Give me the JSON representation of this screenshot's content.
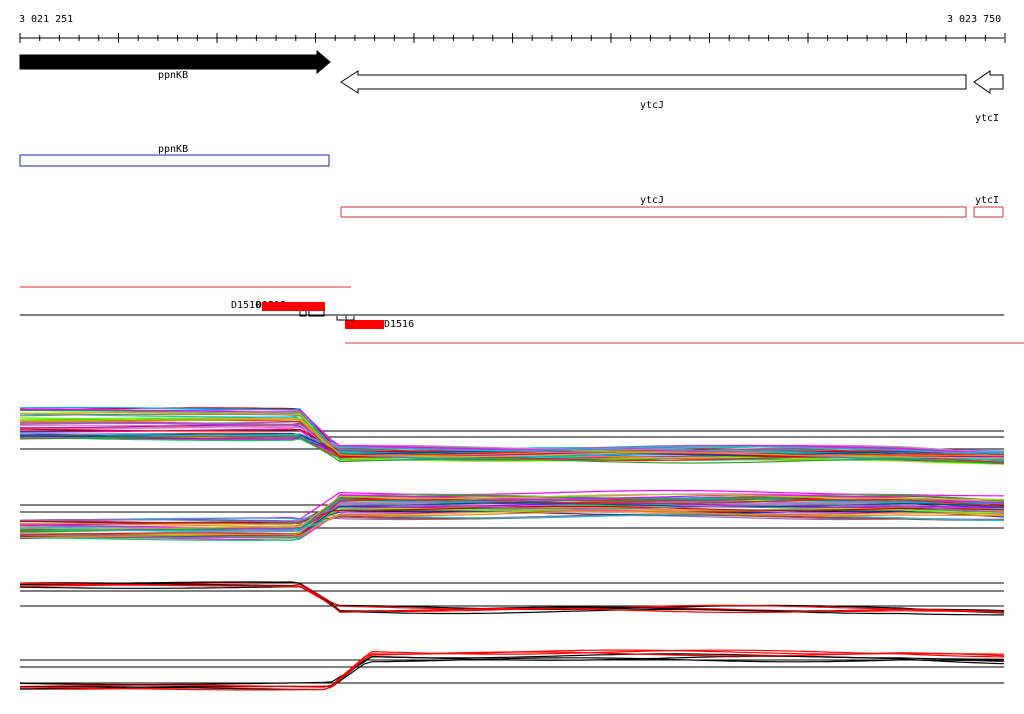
{
  "ruler": {
    "start_label": "3 021 251",
    "end_label": "3 023 750"
  },
  "genes": [
    {
      "name": "ppnKB",
      "strand": "+",
      "fill": "#000000"
    },
    {
      "name": "ytcJ",
      "strand": "-",
      "fill": "#ffffff"
    },
    {
      "name": "ytcI",
      "strand": "-",
      "fill": "#ffffff"
    }
  ],
  "transcript_boxes": [
    {
      "name": "ppnKB",
      "color": "#1f1fb4"
    },
    {
      "name": "ytcJ",
      "color": "#c83232"
    },
    {
      "name": "ytcI",
      "color": "#c83232"
    }
  ],
  "features": [
    {
      "name": "D1510"
    },
    {
      "name": "D1515"
    },
    {
      "name": "D1516"
    }
  ],
  "colors": {
    "feature": "#ff0000",
    "segment_line": "#e03030",
    "axis": "#000000"
  },
  "profile_palette": [
    "#1f3a93",
    "#2ca02c",
    "#d62728",
    "#9467bd",
    "#ff00ff",
    "#17becf",
    "#bcbd22",
    "#ff7f0e",
    "#00cc66",
    "#7f7f7f",
    "#e377c2",
    "#8c564b",
    "#66ff00",
    "#00aaff",
    "#aa00ff",
    "#cc0000"
  ]
}
